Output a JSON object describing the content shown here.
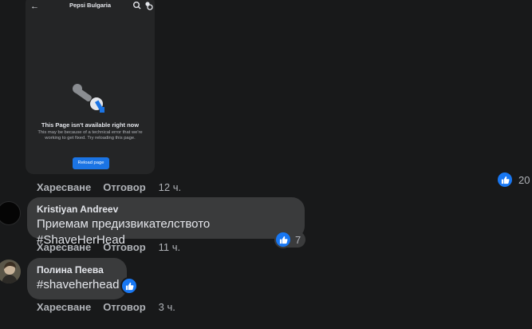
{
  "shot": {
    "page_title": "Pepsi Bulgaria",
    "error_heading": "This Page isn't available right now",
    "error_text": "This may be because of a technical error that we're working to get fixed. Try reloading this page.",
    "reload_label": "Reload page",
    "icons": [
      "back-arrow-icon",
      "search-icon",
      "settings-icon",
      "broken-wrench-icon"
    ]
  },
  "post_actions": {
    "like": "Харесване",
    "reply": "Отговор",
    "time": "12 ч."
  },
  "post_reactions": {
    "count": "20"
  },
  "comments": [
    {
      "author": "Kristiyan Andreev",
      "text": "Приемам предизвикателството #ShaveHerHead",
      "reactions": "7",
      "like": "Харесване",
      "reply": "Отговор",
      "time": "11 ч."
    },
    {
      "author": "Полина Пеева",
      "text": "#shaveherhead",
      "reactions": "",
      "like": "Харесване",
      "reply": "Отговор",
      "time": "3 ч."
    }
  ],
  "colors": {
    "background": "#18191a",
    "bubble": "#3a3b3c",
    "like_blue": "#1877f2",
    "text": "#e4e6eb",
    "muted": "#b0b3b8"
  }
}
